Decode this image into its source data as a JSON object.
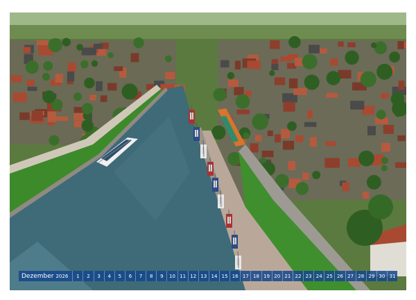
{
  "calendar": {
    "month": "Dezember",
    "year": "2026",
    "days": [
      "1",
      "2",
      "3",
      "4",
      "5",
      "6",
      "7",
      "8",
      "9",
      "10",
      "11",
      "12",
      "13",
      "14",
      "15",
      "16",
      "17",
      "18",
      "19",
      "20",
      "21",
      "22",
      "23",
      "24",
      "25",
      "26",
      "27",
      "28",
      "29",
      "30",
      "31"
    ],
    "bar_color": "#1f5fa8"
  },
  "photo": {
    "colors": {
      "water": "#3f6a78",
      "grass": "#3d8a2a",
      "roof": "#a84a32",
      "tree": "#2f5e22"
    }
  }
}
